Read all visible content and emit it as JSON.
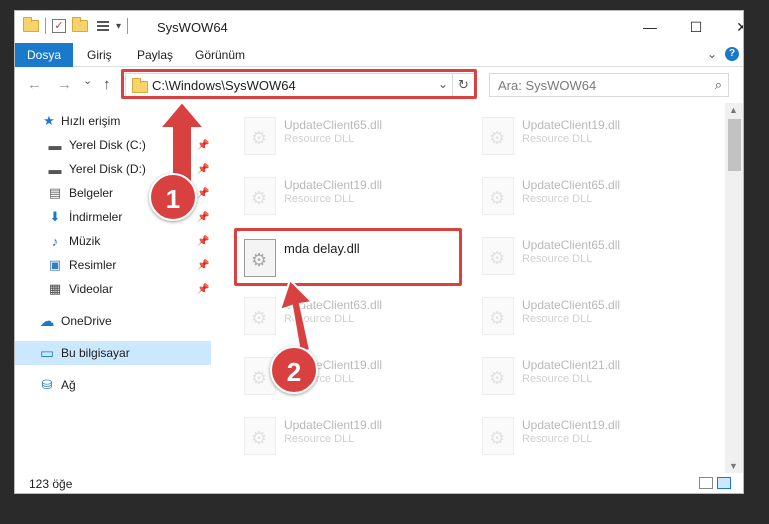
{
  "window": {
    "title": "SysWOW64",
    "minimize_label": "—",
    "maximize_label": "☐",
    "close_label": "✕"
  },
  "ribbon": {
    "tabs": [
      {
        "label": "Dosya"
      },
      {
        "label": "Giriş"
      },
      {
        "label": "Paylaş"
      },
      {
        "label": "Görünüm"
      }
    ],
    "expand_glyph": "⌄",
    "help_glyph": "?"
  },
  "navbar": {
    "back_glyph": "←",
    "forward_glyph": "→",
    "recent_glyph": "⌄",
    "up_glyph": "↑",
    "address": "C:\\Windows\\SysWOW64",
    "address_dropdown_glyph": "⌄",
    "refresh_glyph": "↻",
    "search_placeholder": "Ara: SysWOW64",
    "search_glyph": "⌕"
  },
  "sidebar": {
    "items": [
      {
        "label": "Hızlı erişim",
        "icon": "★"
      },
      {
        "label": "Yerel Disk (C:)",
        "icon": "▬",
        "pin": "📌"
      },
      {
        "label": "Yerel Disk (D:)",
        "icon": "▬",
        "pin": "📌"
      },
      {
        "label": "Belgeler",
        "icon": "▤",
        "pin": "📌"
      },
      {
        "label": "İndirmeler",
        "icon": "⬇",
        "pin": "📌"
      },
      {
        "label": "Müzik",
        "icon": "♪",
        "pin": "📌"
      },
      {
        "label": "Resimler",
        "icon": "▣",
        "pin": "📌"
      },
      {
        "label": "Videolar",
        "icon": "▦",
        "pin": "📌"
      },
      {
        "label": "OneDrive",
        "icon": "☁"
      },
      {
        "label": "Bu bilgisayar",
        "icon": "▭"
      },
      {
        "label": "Ağ",
        "icon": "⛁"
      }
    ]
  },
  "files": [
    {
      "name": "UpdateClient65.dll",
      "type": "Resource DLL"
    },
    {
      "name": "UpdateClient19.dll",
      "type": "Resource DLL"
    },
    {
      "name": "UpdateClient19.dll",
      "type": "Resource DLL"
    },
    {
      "name": "UpdateClient65.dll",
      "type": "Resource DLL"
    },
    {
      "name": "mda delay.dll",
      "type": ""
    },
    {
      "name": "UpdateClient65.dll",
      "type": "Resource DLL"
    },
    {
      "name": "UpdateClient63.dll",
      "type": "Resource DLL"
    },
    {
      "name": "UpdateClient65.dll",
      "type": "Resource DLL"
    },
    {
      "name": "UpdateClient19.dll",
      "type": "Resource DLL"
    },
    {
      "name": "UpdateClient21.dll",
      "type": "Resource DLL"
    },
    {
      "name": "UpdateClient19.dll",
      "type": "Resource DLL"
    },
    {
      "name": "UpdateClient19.dll",
      "type": "Resource DLL"
    }
  ],
  "status": {
    "item_count": "123 öğe"
  },
  "annotations": {
    "step1": "1",
    "step2": "2",
    "highlight_color": "#d94141"
  },
  "scroll": {
    "up_glyph": "▲",
    "down_glyph": "▼"
  }
}
